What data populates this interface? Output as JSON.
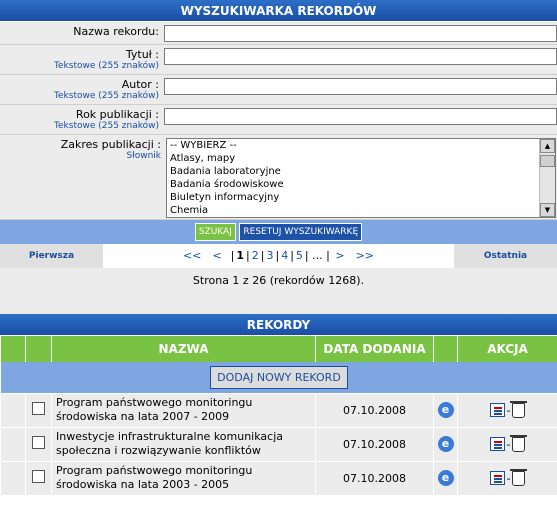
{
  "search": {
    "title": "WYSZUKIWARKA REKORDÓW",
    "fields": [
      {
        "label": "Nazwa rekordu:",
        "hint": ""
      },
      {
        "label": "Tytuł :",
        "hint": "Tekstowe (255 znaków)"
      },
      {
        "label": "Autor :",
        "hint": "Tekstowe (255 znaków)"
      },
      {
        "label": "Rok publikacji :",
        "hint": "Tekstowe (255 znaków)"
      }
    ],
    "scope": {
      "label": "Zakres publikacji :",
      "hint": "Słownik",
      "options": [
        "-- WYBIERZ --",
        "Atlasy, mapy",
        "Badania laboratoryjne",
        "Badania środowiskowe",
        "Biuletyn informacyjny",
        "Chemia"
      ]
    },
    "search_button": "SZUKAJ",
    "reset_button": "RESETUJ WYSZUKIWARKĘ"
  },
  "pager": {
    "first": "Pierwsza",
    "last": "Ostatnia",
    "prev_prev": "<<",
    "prev": "<",
    "pages": [
      "1",
      "2",
      "3",
      "4",
      "5"
    ],
    "current": "1",
    "ellipsis": "...",
    "next": ">",
    "next_next": ">>",
    "status": "Strona 1 z 26 (rekordów 1268)."
  },
  "records": {
    "title": "REKORDY",
    "columns": {
      "name": "NAZWA",
      "date": "DATA DODANIA",
      "action": "AKCJA"
    },
    "add_button": "DODAJ NOWY REKORD",
    "rows": [
      {
        "name": "Program państwowego monitoringu środowiska na lata 2007 - 2009",
        "date": "07.10.2008"
      },
      {
        "name": "Inwestycje infrastrukturalne komunikacja społeczna i rozwiązywanie konfliktów",
        "date": "07.10.2008"
      },
      {
        "name": "Program państwowego monitoringu środowiska na lata 2003 - 2005",
        "date": "07.10.2008"
      }
    ],
    "action_separator": "-"
  },
  "colors": {
    "header_blue": "#1a4ea3",
    "accent_green": "#7ac243",
    "row_bg": "#ececec",
    "bar_light_blue": "#7ea7e2"
  }
}
